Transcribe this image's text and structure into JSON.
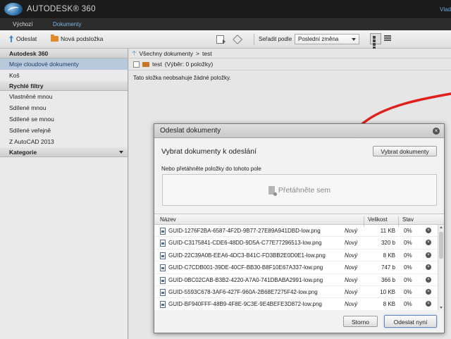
{
  "app": {
    "brand": "AUTODESK® 360",
    "user_link": "Vlad"
  },
  "tabs": [
    {
      "label": "Výchozí"
    },
    {
      "label": "Dokumenty"
    }
  ],
  "toolbar": {
    "upload_label": "Odeslat",
    "new_folder_label": "Nová podsložka",
    "sort_label": "Seřadit podle",
    "sort_value": "Poslední změna"
  },
  "sidebar": {
    "section_autodesk": "Autodesk 360",
    "items": [
      {
        "label": "Moje cloudové dokumenty",
        "active": true
      },
      {
        "label": "Koš"
      }
    ],
    "section_filters": "Rychlé filtry",
    "filters": [
      {
        "label": "Vlastněné mnou"
      },
      {
        "label": "Sdílené mnou"
      },
      {
        "label": "Sdílené se mnou"
      },
      {
        "label": "Sdílené veřejně"
      },
      {
        "label": "Z AutoCAD 2013"
      }
    ],
    "section_categories": "Kategorie"
  },
  "content": {
    "breadcrumb_root": "Všechny dokumenty",
    "breadcrumb_sep": ">",
    "breadcrumb_current": "test",
    "folder_name": "test",
    "selection": "(Výběr: 0 položky)",
    "empty_text": "Tato složka neobsahuje žádné položky."
  },
  "dialog": {
    "title": "Odeslat dokumenty",
    "heading": "Vybrat dokumenty k odeslání",
    "browse_button": "Vybrat dokumenty",
    "drop_hint": "Nebo přetáhněte položky do tohoto pole",
    "drop_zone": "Přetáhněte sem",
    "columns": {
      "name": "Název",
      "size": "Velikost",
      "status": "Stav"
    },
    "files": [
      {
        "name": "GUID-1276F2BA-6587-4F2D-9B77-27E89A941DBD-low.png",
        "state": "Nový",
        "size": "11 KB",
        "progress": "0%"
      },
      {
        "name": "GUID-C3175841-CDE6-48DD-9D5A-C77E77296513-low.png",
        "state": "Nový",
        "size": "320 b",
        "progress": "0%"
      },
      {
        "name": "GUID-22C39A0B-EEA6-4DC3-B41C-FD3BB2E0D0E1-low.png",
        "state": "Nový",
        "size": "8 KB",
        "progress": "0%"
      },
      {
        "name": "GUID-C7CDB001-39DE-40CF-BB30-B8F10E67A337-low.png",
        "state": "Nový",
        "size": "747 b",
        "progress": "0%"
      },
      {
        "name": "GUID-0BC02CAB-B3B2-4220-A7A0-741DBABA2991-low.png",
        "state": "Nový",
        "size": "366 b",
        "progress": "0%"
      },
      {
        "name": "GUID-5593C678-3AF6-427F-960A-2B68E7275F42-low.png",
        "state": "Nový",
        "size": "10 KB",
        "progress": "0%"
      },
      {
        "name": "GUID-BF940FFF-48B9-4F8E-9C3E-9E4BEFE3D872-low.png",
        "state": "Nový",
        "size": "8 KB",
        "progress": "0%"
      }
    ],
    "cancel_button": "Storno",
    "send_button": "Odeslat nyní"
  },
  "colors": {
    "annotation_arrow": "#e0201c",
    "active_item": "#b8c9dc",
    "link": "#6aa7d8"
  }
}
